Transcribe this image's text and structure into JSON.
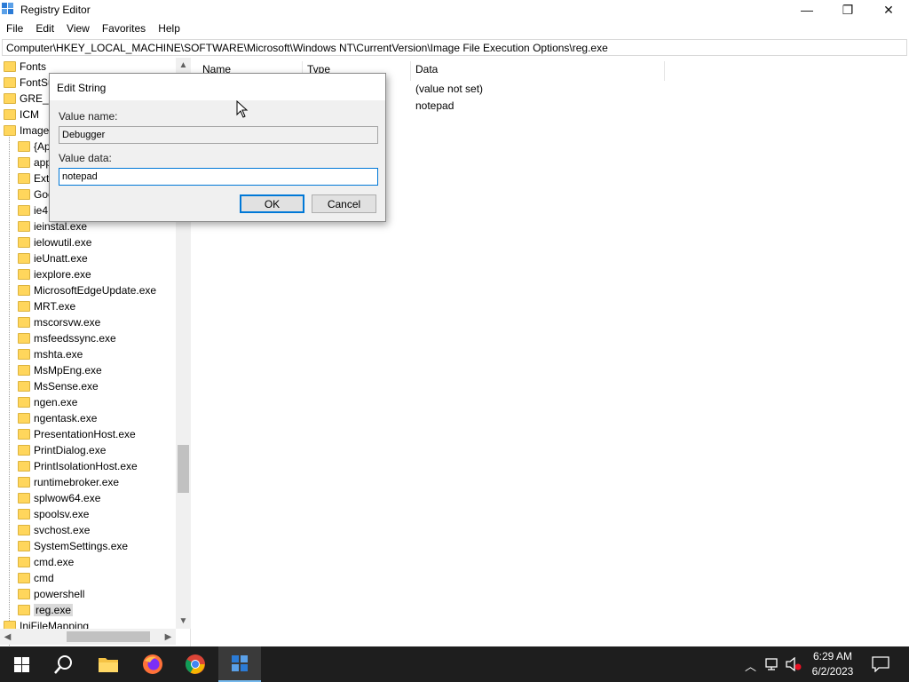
{
  "window": {
    "title": "Registry Editor",
    "minimize_glyph": "—",
    "maximize_glyph": "❐",
    "close_glyph": "✕"
  },
  "menu": [
    "File",
    "Edit",
    "View",
    "Favorites",
    "Help"
  ],
  "address": "Computer\\HKEY_LOCAL_MACHINE\\SOFTWARE\\Microsoft\\Windows NT\\CurrentVersion\\Image File Execution Options\\reg.exe",
  "tree": {
    "items": [
      {
        "label": "Fonts",
        "level": 0
      },
      {
        "label": "FontSu",
        "level": 0
      },
      {
        "label": "GRE_In",
        "level": 0
      },
      {
        "label": "ICM",
        "level": 0
      },
      {
        "label": "Image",
        "level": 0
      },
      {
        "label": "{Ap",
        "level": 1
      },
      {
        "label": "app",
        "level": 1
      },
      {
        "label": "Ext",
        "level": 1
      },
      {
        "label": "Goo",
        "level": 1
      },
      {
        "label": "ie4",
        "level": 1
      },
      {
        "label": "ieinstal.exe",
        "level": 1
      },
      {
        "label": "ielowutil.exe",
        "level": 1
      },
      {
        "label": "ieUnatt.exe",
        "level": 1
      },
      {
        "label": "iexplore.exe",
        "level": 1
      },
      {
        "label": "MicrosoftEdgeUpdate.exe",
        "level": 1
      },
      {
        "label": "MRT.exe",
        "level": 1
      },
      {
        "label": "mscorsvw.exe",
        "level": 1
      },
      {
        "label": "msfeedssync.exe",
        "level": 1
      },
      {
        "label": "mshta.exe",
        "level": 1
      },
      {
        "label": "MsMpEng.exe",
        "level": 1
      },
      {
        "label": "MsSense.exe",
        "level": 1
      },
      {
        "label": "ngen.exe",
        "level": 1
      },
      {
        "label": "ngentask.exe",
        "level": 1
      },
      {
        "label": "PresentationHost.exe",
        "level": 1
      },
      {
        "label": "PrintDialog.exe",
        "level": 1
      },
      {
        "label": "PrintIsolationHost.exe",
        "level": 1
      },
      {
        "label": "runtimebroker.exe",
        "level": 1
      },
      {
        "label": "splwow64.exe",
        "level": 1
      },
      {
        "label": "spoolsv.exe",
        "level": 1
      },
      {
        "label": "svchost.exe",
        "level": 1
      },
      {
        "label": "SystemSettings.exe",
        "level": 1
      },
      {
        "label": "cmd.exe",
        "level": 1
      },
      {
        "label": "cmd",
        "level": 1
      },
      {
        "label": "powershell",
        "level": 1
      },
      {
        "label": "reg.exe",
        "level": 1,
        "selected": true
      },
      {
        "label": "IniFileMapping",
        "level": 0
      }
    ]
  },
  "list": {
    "columns": [
      "Name",
      "Type",
      "Data"
    ],
    "rows": [
      {
        "data": "(value not set)"
      },
      {
        "data": "notepad"
      }
    ]
  },
  "dialog": {
    "title": "Edit String",
    "value_name_label": "Value name:",
    "value_name": "Debugger",
    "value_data_label": "Value data:",
    "value_data": "notepad",
    "ok_label": "OK",
    "cancel_label": "Cancel"
  },
  "taskbar": {
    "time": "6:29 AM",
    "date": "6/2/2023",
    "apps": [
      "start-icon",
      "search-icon",
      "file-explorer-icon",
      "firefox-icon",
      "chrome-icon",
      "registry-editor-icon"
    ]
  },
  "colors": {
    "accent": "#0078d7",
    "folder": "#ffd65c",
    "taskbar": "#1e1e1e"
  }
}
